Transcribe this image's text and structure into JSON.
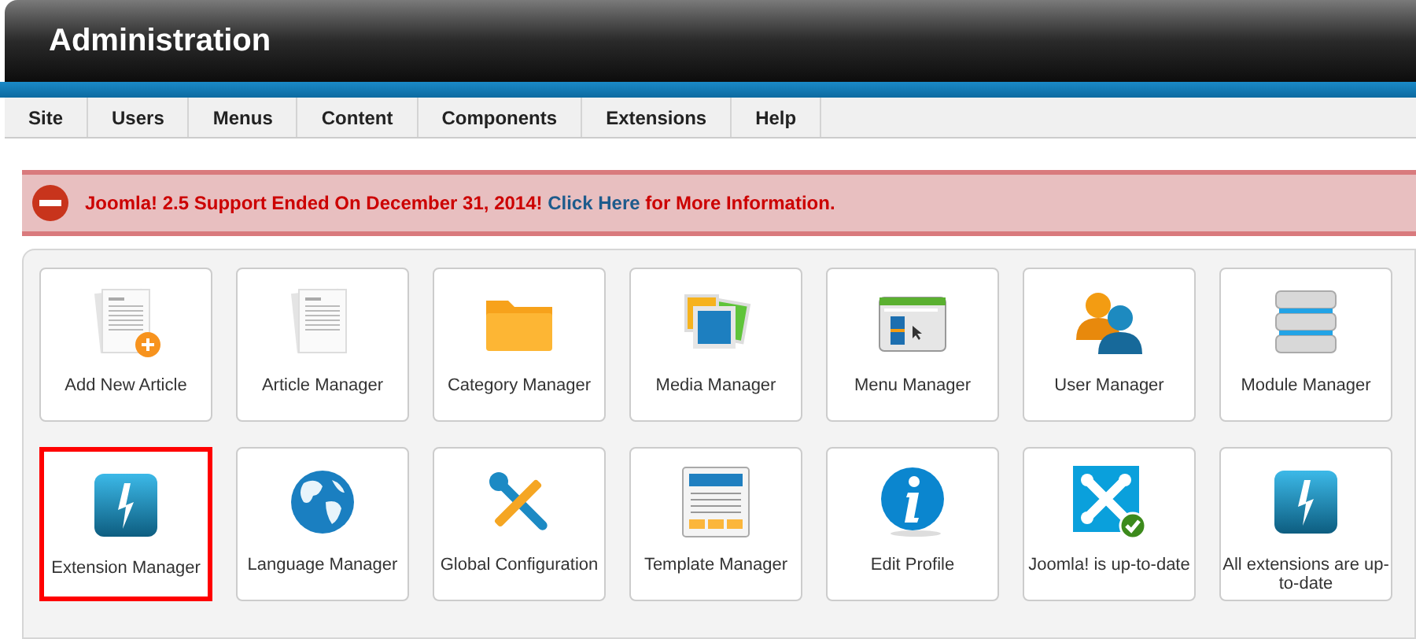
{
  "header": {
    "title": "Administration"
  },
  "menu": [
    {
      "label": "Site"
    },
    {
      "label": "Users"
    },
    {
      "label": "Menus"
    },
    {
      "label": "Content"
    },
    {
      "label": "Components"
    },
    {
      "label": "Extensions"
    },
    {
      "label": "Help"
    }
  ],
  "alert": {
    "before": "Joomla! 2.5 Support Ended On December 31, 2014! ",
    "link": "Click Here",
    "after": " for More Information."
  },
  "tiles": [
    {
      "label": "Add New Article",
      "kind": "article-add",
      "highlighted": false
    },
    {
      "label": "Article Manager",
      "kind": "article",
      "highlighted": false
    },
    {
      "label": "Category Manager",
      "kind": "folder",
      "highlighted": false
    },
    {
      "label": "Media Manager",
      "kind": "media",
      "highlighted": false
    },
    {
      "label": "Menu Manager",
      "kind": "menu",
      "highlighted": false
    },
    {
      "label": "User Manager",
      "kind": "users",
      "highlighted": false
    },
    {
      "label": "Module Manager",
      "kind": "modules",
      "highlighted": false
    },
    {
      "label": "Extension Manager",
      "kind": "extension",
      "highlighted": true
    },
    {
      "label": "Language Manager",
      "kind": "globe",
      "highlighted": false
    },
    {
      "label": "Global Configuration",
      "kind": "tools",
      "highlighted": false
    },
    {
      "label": "Template Manager",
      "kind": "template",
      "highlighted": false
    },
    {
      "label": "Edit Profile",
      "kind": "info",
      "highlighted": false
    },
    {
      "label": "Joomla! is up-to-date",
      "kind": "joomla",
      "highlighted": false
    },
    {
      "label": "All extensions are up-to-date",
      "kind": "extension",
      "highlighted": false
    }
  ]
}
